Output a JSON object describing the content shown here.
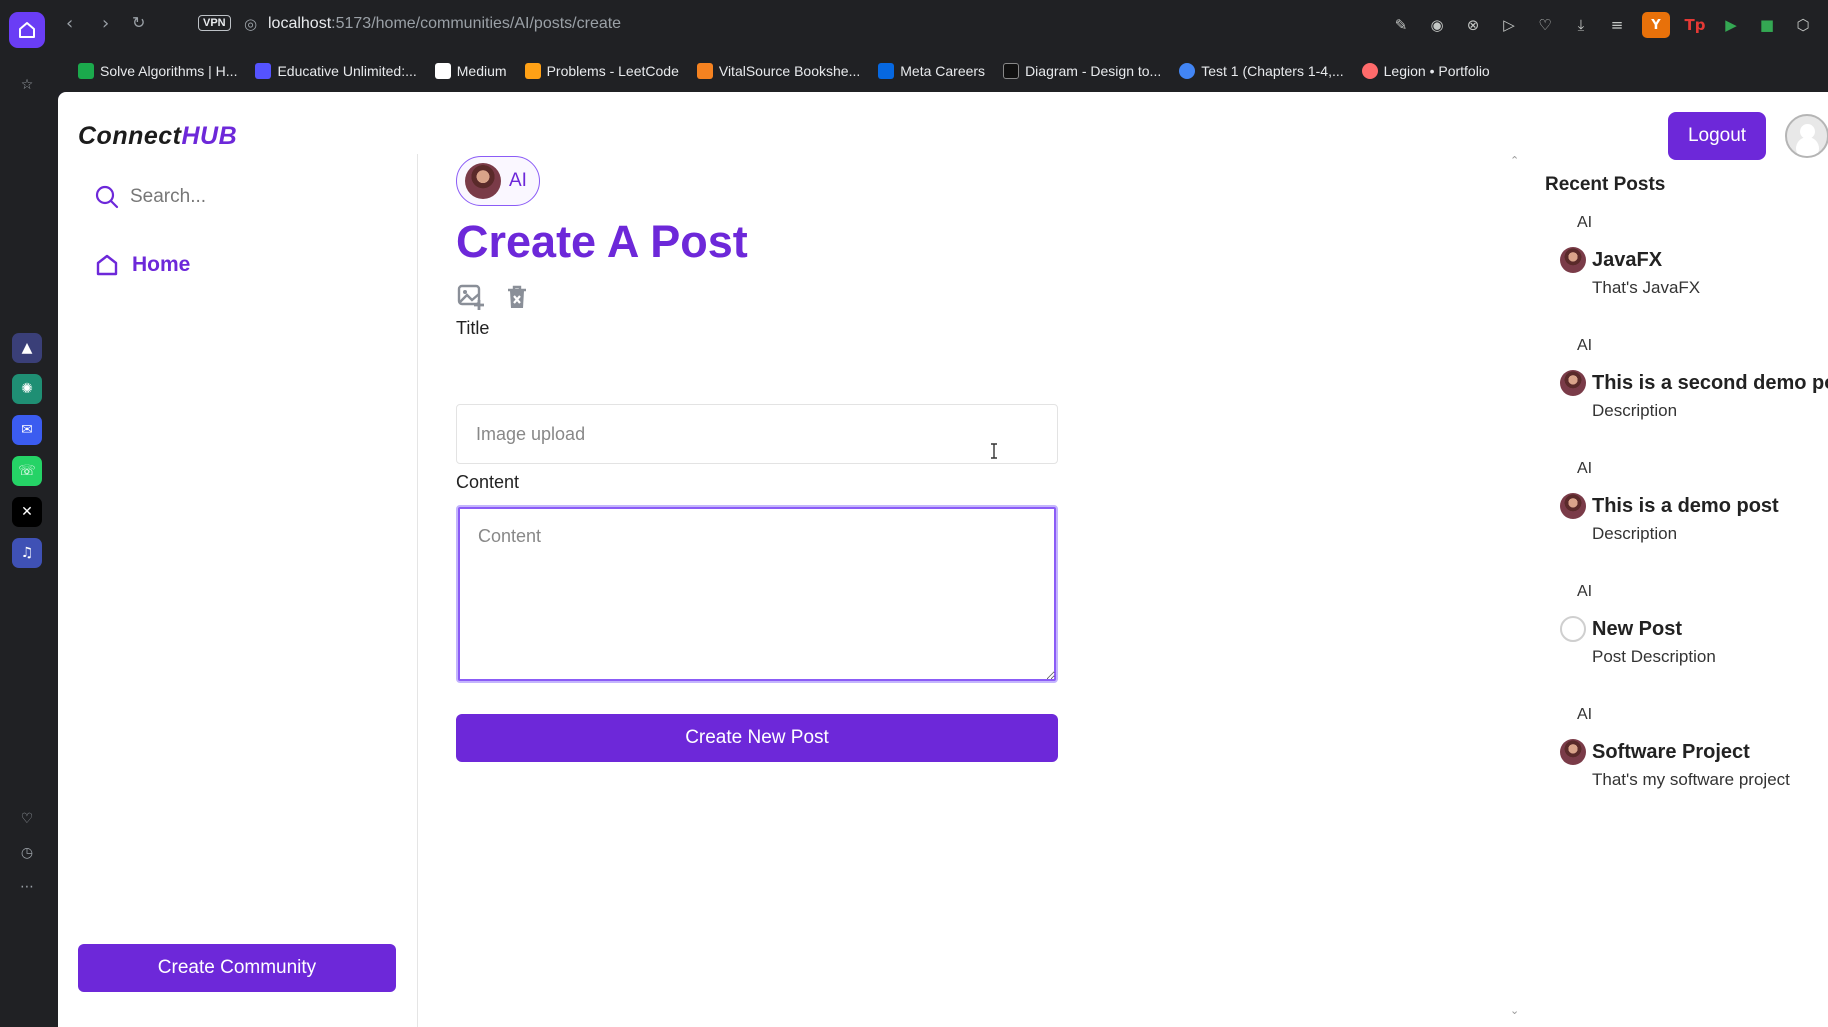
{
  "browser": {
    "url_host": "localhost",
    "url_path": ":5173/home/communities/AI/posts/create",
    "vpn_label": "VPN",
    "profile_letter": "Y",
    "extension_tp": "Tp",
    "bookmarks": [
      {
        "label": "Solve Algorithms | H...",
        "color": "#1ba94c"
      },
      {
        "label": "Educative Unlimited:...",
        "color": "#5553ff"
      },
      {
        "label": "Medium",
        "color": "#ffffff"
      },
      {
        "label": "Problems - LeetCode",
        "color": "#ffa116"
      },
      {
        "label": "VitalSource Bookshe...",
        "color": "#f58220"
      },
      {
        "label": "Meta Careers",
        "color": "#0668e1"
      },
      {
        "label": "Diagram - Design to...",
        "color": "#111111"
      },
      {
        "label": "Test 1 (Chapters 1-4,...",
        "color": "#4285f4"
      },
      {
        "label": "Legion • Portfolio",
        "color": "#ff6b6b"
      }
    ]
  },
  "app": {
    "logo_prefix": "Connect",
    "logo_suffix": "HUB",
    "logout_label": "Logout",
    "accent": "#6d28d9"
  },
  "sidebar": {
    "search_placeholder": "Search...",
    "home_label": "Home",
    "create_community_label": "Create Community"
  },
  "main": {
    "community": "AI",
    "heading": "Create A Post",
    "title_label": "Title",
    "title_placeholder": "Image upload",
    "content_label": "Content",
    "content_placeholder": "Content",
    "submit_label": "Create New Post"
  },
  "recent": {
    "heading": "Recent Posts",
    "posts": [
      {
        "community": "AI",
        "title": "JavaFX",
        "description": "That's JavaFX"
      },
      {
        "community": "AI",
        "title": "This is a second demo post",
        "description": "Description"
      },
      {
        "community": "AI",
        "title": "This is a demo post",
        "description": "Description"
      },
      {
        "community": "AI",
        "title": "New Post",
        "description": "Post Description"
      },
      {
        "community": "AI",
        "title": "Software Project",
        "description": "That's my software project"
      }
    ]
  }
}
